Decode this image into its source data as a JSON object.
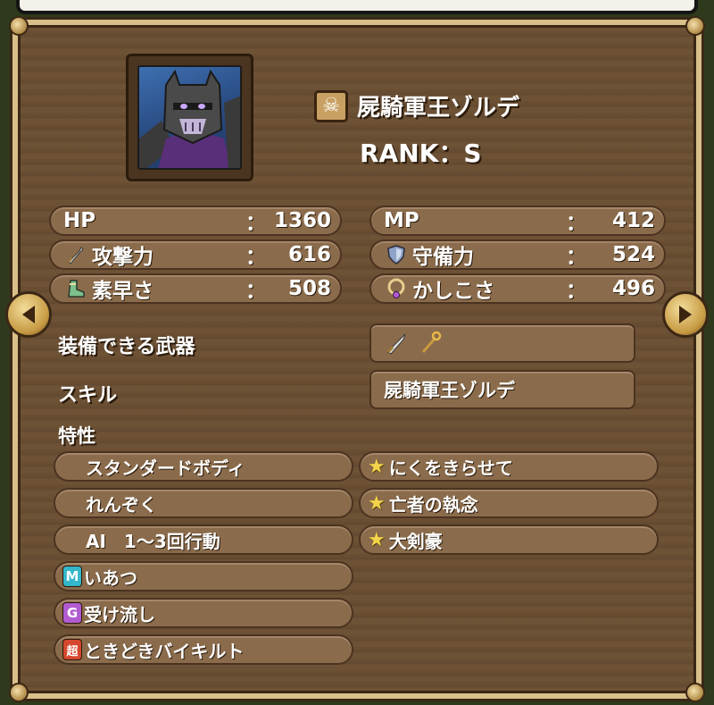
{
  "monster": {
    "name": "屍騎軍王ゾルデ",
    "rank": "RANK：S",
    "type_icon": "skull-icon"
  },
  "stats": {
    "hp": {
      "label": "HP",
      "colon": "：",
      "value": "1360"
    },
    "mp": {
      "label": "MP",
      "colon": "：",
      "value": "412"
    },
    "attack": {
      "label": "攻撃力",
      "colon": "：",
      "value": "616",
      "icon": "sword-icon"
    },
    "defense": {
      "label": "守備力",
      "colon": "：",
      "value": "524",
      "icon": "shield-icon"
    },
    "agility": {
      "label": "素早さ",
      "colon": "：",
      "value": "508",
      "icon": "boot-icon"
    },
    "wisdom": {
      "label": "かしこさ",
      "colon": "：",
      "value": "496",
      "icon": "ring-icon"
    }
  },
  "equipment": {
    "label": "装備できる武器",
    "icons": [
      "sword-icon",
      "staff-icon"
    ]
  },
  "skill": {
    "label": "スキル",
    "value": "屍騎軍王ゾルデ"
  },
  "traits": {
    "label": "特性",
    "left": [
      {
        "text": "スタンダードボディ",
        "badge": ""
      },
      {
        "text": "れんぞく",
        "badge": ""
      },
      {
        "text": "AI　1～3回行動",
        "badge": ""
      },
      {
        "text": "いあつ",
        "badge": "M",
        "badge_color": "#34b7c9"
      },
      {
        "text": "受け流し",
        "badge": "G",
        "badge_color": "#b15bd1"
      },
      {
        "text": "ときどきバイキルト",
        "badge": "超",
        "badge_color": "#d5482e"
      }
    ],
    "right": [
      {
        "text": "にくをきらせて",
        "star": "half"
      },
      {
        "text": "亡者の執念",
        "star": "half"
      },
      {
        "text": "大剣豪",
        "star": "full"
      }
    ]
  },
  "colors": {
    "panel_wood": "#6e5236",
    "pill": "#8a6b4b",
    "frame_gold": "#d9c08a",
    "star": "#f3d44a"
  }
}
